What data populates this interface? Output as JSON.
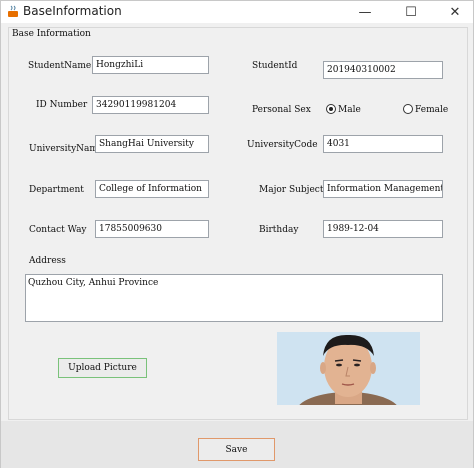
{
  "window": {
    "title": "BaseInformation",
    "minimize_symbol": "—",
    "maximize_symbol": "☐",
    "close_symbol": "✕"
  },
  "form": {
    "section_title": "Base Information",
    "student_name": {
      "label": "StudentName",
      "value": "HongzhiLi"
    },
    "student_id": {
      "label": "StudentId",
      "value": "201940310002"
    },
    "id_number": {
      "label": "ID Number",
      "value": "34290119981204"
    },
    "personal_sex": {
      "label": "Personal  Sex",
      "options": [
        {
          "label": "Male",
          "selected": true
        },
        {
          "label": "Female",
          "selected": false
        }
      ]
    },
    "university_name": {
      "label": "UniversityName",
      "value": "ShangHai University"
    },
    "university_code": {
      "label": "UniversityCode",
      "value": "4031"
    },
    "department": {
      "label": "Department",
      "value": "College of Information"
    },
    "major_subject": {
      "label": "Major Subject",
      "value": "Information Management"
    },
    "contact_way": {
      "label": "Contact Way",
      "value": "17855009630"
    },
    "birthday": {
      "label": "Birthday",
      "value": "1989-12-04"
    },
    "address": {
      "label": "Address",
      "value": "Quzhou City, Anhui Province"
    },
    "upload_button": "Upload Picture",
    "save_button": "Save"
  },
  "colors": {
    "window_bg": "#f0f0f0",
    "field_border": "#9da3aa",
    "upload_border": "#7ac27a",
    "save_border": "#e0986a",
    "photo_bg": "#cfe3f1"
  }
}
